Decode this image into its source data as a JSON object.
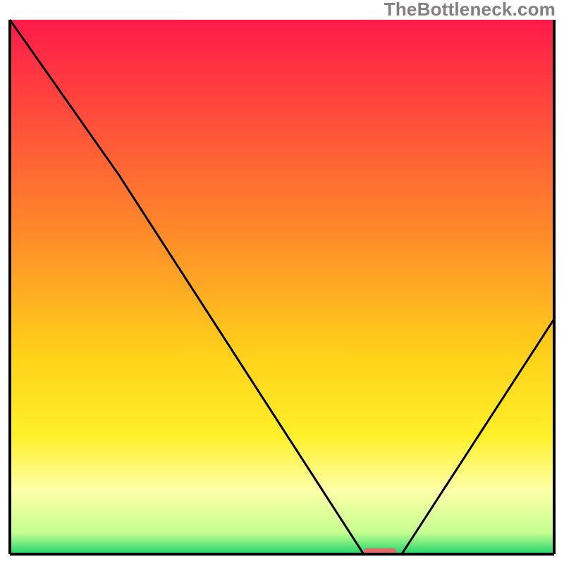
{
  "watermark": "TheBottleneck.com",
  "chart_data": {
    "type": "line",
    "title": "",
    "xlabel": "",
    "ylabel": "",
    "xlim": [
      0,
      100
    ],
    "ylim": [
      0,
      100
    ],
    "x": [
      0,
      20,
      65,
      72,
      100
    ],
    "values": [
      100,
      71,
      0,
      0,
      44
    ],
    "notes": "Black curve overlaid on red→yellow→green vertical gradient. Minimum (trough) at roughly x≈65–72%. Curve starts at top-left corner, descends with a slight knee near x≈20% y≈71%, reaches 0, stays flat briefly, then rises to y≈44% at right edge. No axis ticks or labels are shown.",
    "gradient_stops": [
      {
        "offset": 0,
        "color": "#ff1a4a"
      },
      {
        "offset": 40,
        "color": "#ff8a2a"
      },
      {
        "offset": 63,
        "color": "#ffd21a"
      },
      {
        "offset": 78,
        "color": "#fff02a"
      },
      {
        "offset": 88,
        "color": "#fdffa8"
      },
      {
        "offset": 96,
        "color": "#c6ff90"
      },
      {
        "offset": 100,
        "color": "#1fd46a"
      }
    ],
    "marker": {
      "x": 68,
      "y": 0.5,
      "color": "#e36a6a",
      "w": 6,
      "h": 1.2
    }
  },
  "plot": {
    "outer_w": 800,
    "outer_h": 800,
    "inner_x": 14,
    "inner_y": 28,
    "inner_w": 772,
    "inner_h": 758,
    "axis_stroke": "#000000",
    "axis_width": 4,
    "curve_stroke": "#000000",
    "curve_width": 3
  }
}
